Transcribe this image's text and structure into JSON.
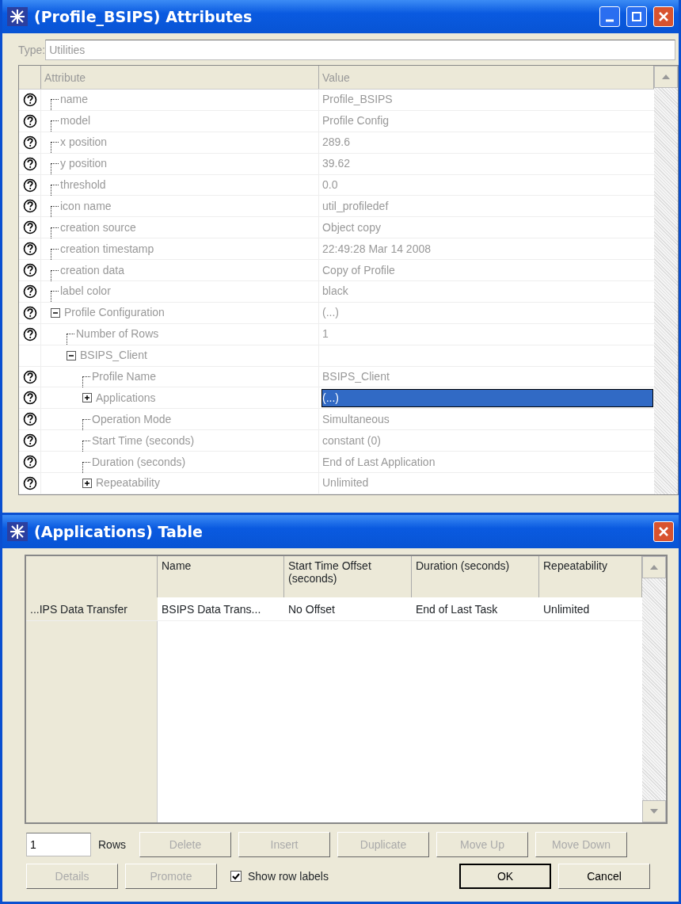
{
  "attributes_window": {
    "title": "(Profile_BSIPS) Attributes",
    "type_label": "Type:",
    "type_value": "Utilities",
    "columns": [
      "Attribute",
      "Value"
    ],
    "rows": [
      {
        "name": "name",
        "value": "Profile_BSIPS",
        "help": true,
        "selected": false
      },
      {
        "name": "model",
        "value": "Profile Config",
        "help": true,
        "selected": false
      },
      {
        "name": "x position",
        "value": "289.6",
        "help": true,
        "selected": false
      },
      {
        "name": "y position",
        "value": "39.62",
        "help": true,
        "selected": false
      },
      {
        "name": "threshold",
        "value": "0.0",
        "help": true,
        "selected": false
      },
      {
        "name": "icon name",
        "value": "util_profiledef",
        "help": true,
        "selected": false
      },
      {
        "name": "creation source",
        "value": "Object copy",
        "help": true,
        "selected": false
      },
      {
        "name": "creation timestamp",
        "value": "22:49:28 Mar 14 2008",
        "help": true,
        "selected": false
      },
      {
        "name": "creation data",
        "value": "Copy of Profile",
        "help": true,
        "selected": false
      },
      {
        "name": "label color",
        "value": "black",
        "help": true,
        "selected": false
      },
      {
        "name": "Profile Configuration",
        "value": "(...)",
        "help": true,
        "selected": false,
        "expanded": true,
        "children": [
          {
            "name": "Number of Rows",
            "value": "1",
            "help": true,
            "selected": false
          },
          {
            "name": "BSIPS_Client",
            "help": false,
            "selected": false,
            "expanded": true,
            "children": [
              {
                "name": "Profile Name",
                "value": "BSIPS_Client",
                "help": true,
                "selected": false
              },
              {
                "name": "Applications",
                "value": "(...)",
                "help": true,
                "selected": true,
                "expanded": false
              },
              {
                "name": "Operation Mode",
                "value": "Simultaneous",
                "help": true,
                "selected": false
              },
              {
                "name": "Start Time (seconds)",
                "value": "constant (0)",
                "help": true,
                "selected": false
              },
              {
                "name": "Duration (seconds)",
                "value": "End of Last Application",
                "help": true,
                "selected": false
              },
              {
                "name": "Repeatability",
                "value": "Unlimited",
                "help": true,
                "selected": false,
                "expanded": false
              }
            ]
          }
        ]
      }
    ]
  },
  "table_window": {
    "title": "(Applications) Table",
    "columns": [
      "Name",
      "Start Time Offset (seconds)",
      "Duration (seconds)",
      "Repeatability"
    ],
    "rows": [
      {
        "label": "...IPS Data Transfer",
        "cells": [
          "BSIPS Data Trans...",
          "No Offset",
          "End of Last Task",
          "Unlimited"
        ]
      }
    ],
    "rows_count": "1",
    "rows_label": "Rows",
    "row_buttons": [
      {
        "label": "Delete",
        "disabled": true
      },
      {
        "label": "Insert",
        "disabled": true
      },
      {
        "label": "Duplicate",
        "disabled": true
      },
      {
        "label": "Move Up",
        "disabled": true
      },
      {
        "label": "Move Down",
        "disabled": true
      }
    ],
    "bottom_buttons": [
      {
        "label": "Details",
        "disabled": true
      },
      {
        "label": "Promote",
        "disabled": true
      }
    ],
    "show_row_labels": {
      "label": "Show row labels",
      "checked": true
    },
    "dialog_buttons": [
      {
        "label": "OK",
        "disabled": false,
        "default": true
      },
      {
        "label": "Cancel",
        "disabled": false,
        "default": false
      }
    ]
  }
}
